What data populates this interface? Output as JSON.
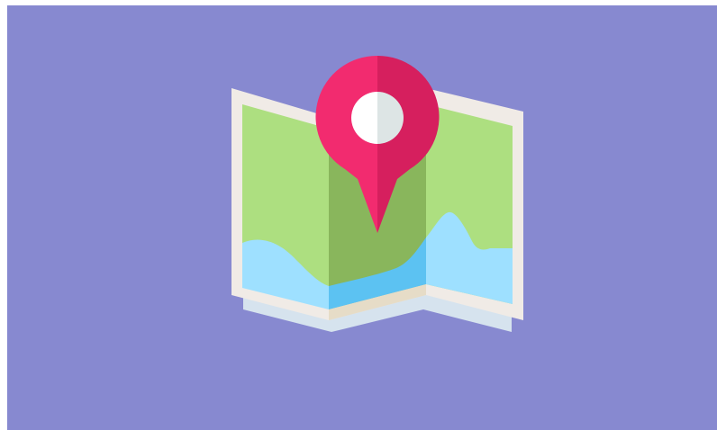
{
  "illustration": {
    "icon": "folded-map-with-location-pin-icon",
    "colors": {
      "background": "#8789D0",
      "paper": "#F0EBE6",
      "paper_shadow": "#D6E3EE",
      "paper_fold_middle": "#E6DCC7",
      "land_light": "#ADDF80",
      "land_dark": "#89B65C",
      "water_light": "#9EE0FF",
      "water_dark": "#5CC2F2",
      "pin_left": "#F22B6F",
      "pin_right": "#D61F5E",
      "pin_hole_left": "#FFFFFF",
      "pin_hole_right": "#DDE5E5"
    }
  }
}
